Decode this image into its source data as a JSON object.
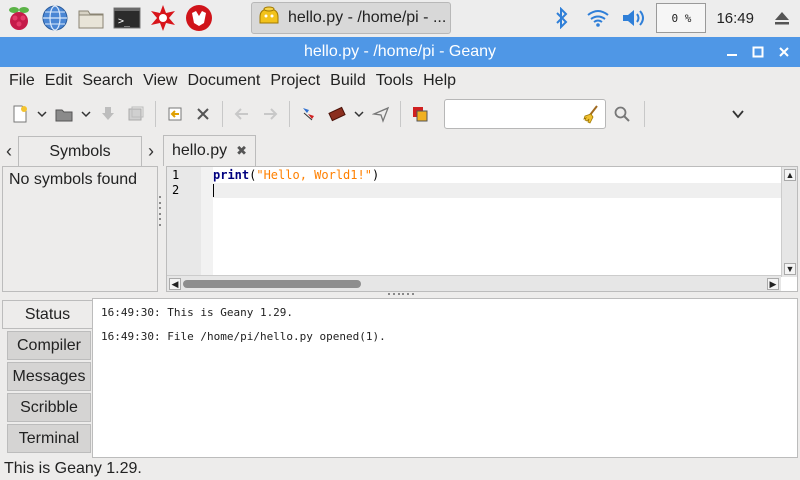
{
  "taskbar": {
    "launchers": [
      "raspberry-menu-icon",
      "web-browser-icon",
      "file-manager-icon",
      "terminal-icon",
      "mathematica-icon",
      "wolfram-icon"
    ],
    "task_title": "hello.py - /home/pi - ...",
    "cpu_usage": "0 %",
    "clock": "16:49"
  },
  "window": {
    "title": "hello.py - /home/pi - Geany"
  },
  "menubar": {
    "items": [
      "File",
      "Edit",
      "Search",
      "View",
      "Document",
      "Project",
      "Build",
      "Tools",
      "Help"
    ]
  },
  "toolbar": {
    "search_value": "",
    "search_placeholder": ""
  },
  "sidebar": {
    "tab_label": "Symbols",
    "empty_text": "No symbols found"
  },
  "editor": {
    "tab_label": "hello.py",
    "line_numbers": [
      "1",
      "2"
    ],
    "code": {
      "keyword": "print",
      "open": "(",
      "string": "\"Hello, World1!\"",
      "close": ")"
    }
  },
  "messages": {
    "tabs": [
      "Status",
      "Compiler",
      "Messages",
      "Scribble",
      "Terminal"
    ],
    "active_tab": "Status",
    "lines": [
      "16:49:30: This is Geany 1.29.",
      "16:49:30: File /home/pi/hello.py opened(1)."
    ]
  },
  "statusbar": {
    "text": "This is Geany 1.29."
  },
  "colors": {
    "titlebar": "#4f97e6",
    "keyword": "#00007f",
    "string": "#ff8000"
  }
}
